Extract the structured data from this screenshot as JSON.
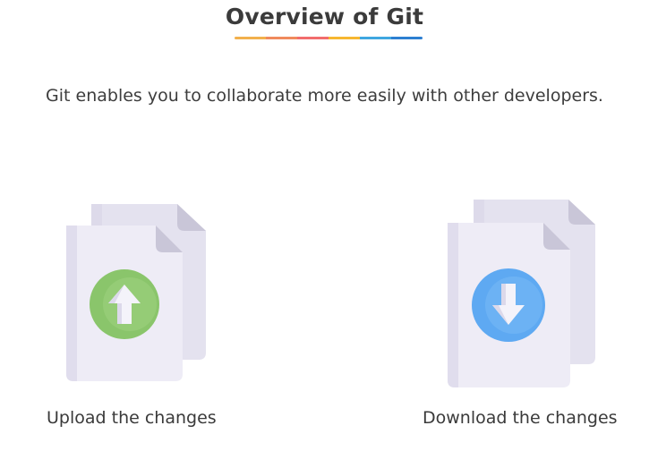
{
  "header": {
    "title": "Overview of Git",
    "underline_colors": [
      "#f2b04c",
      "#f08a5d",
      "#f26d6d",
      "#f7b731",
      "#3fa7e0",
      "#2d7fd1"
    ]
  },
  "intro": {
    "text": "Git enables you to collaborate more easily with other developers."
  },
  "items": [
    {
      "caption": "Upload the changes",
      "icon": "upload-document-icon",
      "badge_color": "#8ac56b"
    },
    {
      "caption": "Download the changes",
      "icon": "download-document-icon",
      "badge_color": "#5ea9f2"
    }
  ],
  "colors": {
    "paper_back": "#e4e2ef",
    "paper_front": "#eeecf6",
    "paper_fold": "#c9c6d8",
    "text": "#3a3a3a"
  }
}
